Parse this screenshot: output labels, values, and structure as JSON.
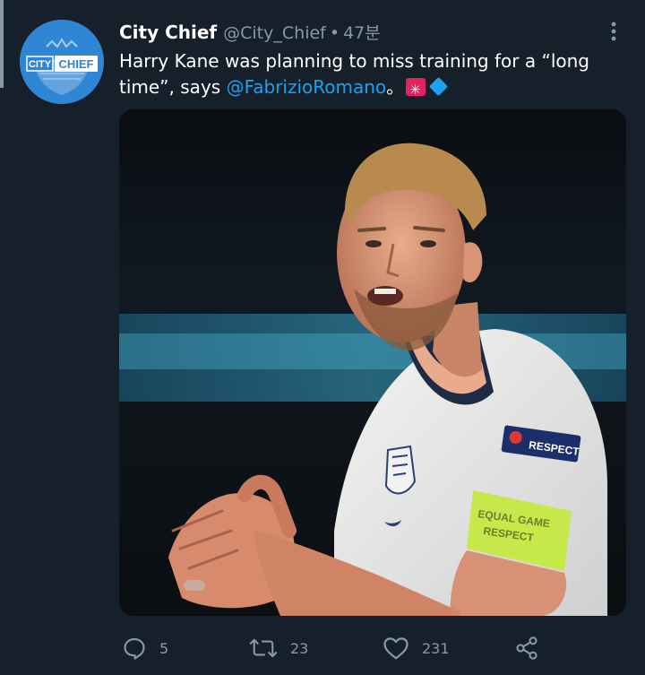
{
  "tweet": {
    "author": {
      "display_name": "City Chief",
      "handle": "@City_Chief",
      "separator": "•",
      "time": "47분",
      "avatar_text": "CITY CHIEF",
      "avatar_text_1": "CITY",
      "avatar_text_2": "CHIEF"
    },
    "text_part1": "Harry Kane was planning to miss training for a “long time”, says ",
    "mention": "@FabrizioRomano",
    "text_part2": "。",
    "emojis": [
      "rotating-light-emoji",
      "blue-diamond-emoji"
    ],
    "media": {
      "description_icon": "photo",
      "badge_respect": "RESPECT",
      "armband_line1": "EQUAL GAME",
      "armband_line2": "RESPECT"
    },
    "actions": {
      "reply_count": "5",
      "retweet_count": "23",
      "like_count": "231"
    }
  },
  "colors": {
    "background": "#15202b",
    "secondary_text": "#8899a6",
    "link": "#1da1f2",
    "armband": "#c6e84a"
  }
}
